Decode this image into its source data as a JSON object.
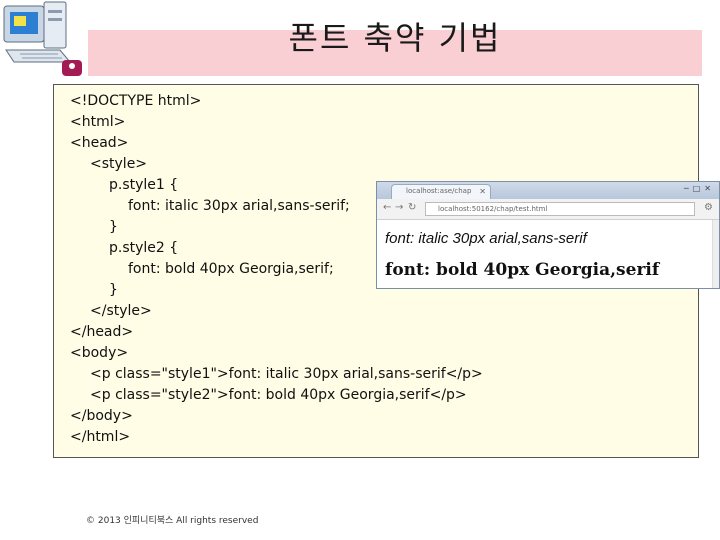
{
  "slide": {
    "title": "폰트 축약 기법",
    "footer": "© 2013 인피니티북스 All rights reserved"
  },
  "code_lines": [
    "<!DOCTYPE html>",
    "<html>",
    "<head>",
    "<style>",
    "p.style1 {",
    "font: italic 30px arial,sans-serif;",
    "}",
    "p.style2 {",
    "font: bold 40px Georgia,serif;",
    "}",
    "</style>",
    "</head>",
    "<body>",
    "<p class=\"style1\">font: italic 30px arial,sans-serif</p>",
    "<p class=\"style2\">font: bold 40px Georgia,serif</p>",
    "</body>",
    "</html>"
  ],
  "browser": {
    "tab_title": "localhost:ase/chap",
    "address": "localhost:50162/chap/test.html",
    "output_line1": "font: italic 30px arial,sans-serif",
    "output_line2": "font: bold 40px Georgia,serif"
  }
}
